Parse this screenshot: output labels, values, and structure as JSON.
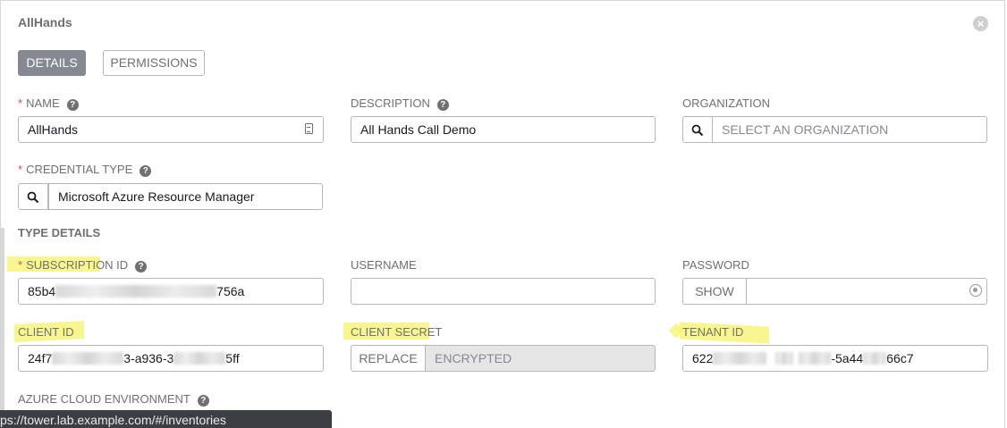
{
  "dialog": {
    "title": "AllHands"
  },
  "tabs": {
    "details": "DETAILS",
    "permissions": "PERMISSIONS"
  },
  "fields": {
    "name": {
      "label": "NAME",
      "required": "*",
      "value": "AllHands"
    },
    "description": {
      "label": "DESCRIPTION",
      "value": "All Hands Call Demo"
    },
    "organization": {
      "label": "ORGANIZATION",
      "placeholder": "SELECT AN ORGANIZATION"
    },
    "credential_type": {
      "label": "CREDENTIAL TYPE",
      "required": "*",
      "value": "Microsoft Azure Resource Manager"
    }
  },
  "type_details": {
    "heading": "TYPE DETAILS",
    "subscription_id": {
      "label": "SUBSCRIPTION ID",
      "required": "*",
      "value_start": "85b4",
      "value_end": "756a"
    },
    "username": {
      "label": "USERNAME",
      "value": ""
    },
    "password": {
      "label": "PASSWORD",
      "show_label": "SHOW"
    },
    "client_id": {
      "label": "CLIENT ID",
      "value_a": "24f7",
      "value_b": "3-a936-3",
      "value_c": "5ff"
    },
    "client_secret": {
      "label": "CLIENT SECRET",
      "replace_label": "REPLACE",
      "encrypted_label": "ENCRYPTED"
    },
    "tenant_id": {
      "label": "TENANT ID",
      "value_a": "622",
      "value_b": "-5a44",
      "value_c": "66c7"
    },
    "azure_cloud_environment": {
      "label": "AZURE CLOUD ENVIRONMENT"
    }
  },
  "status_bar": {
    "url": "ps://tower.lab.example.com/#/inventories"
  },
  "colors": {
    "highlight": "#f6f46a",
    "required": "#d9534f",
    "active_tab": "#848992"
  }
}
